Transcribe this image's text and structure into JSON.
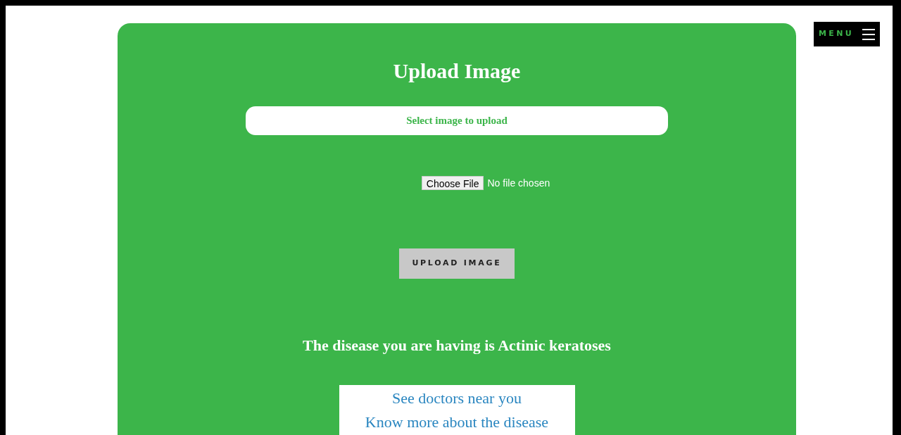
{
  "menu": {
    "label": "MENU"
  },
  "upload": {
    "title": "Upload Image",
    "select_label": "Select image to upload",
    "file_button": "Choose File",
    "file_status": "No file chosen",
    "submit": "UPLOAD IMAGE"
  },
  "result": {
    "text": "The disease you are having is Actinic keratoses"
  },
  "links": [
    "See doctors near you",
    "Know more about the disease"
  ]
}
